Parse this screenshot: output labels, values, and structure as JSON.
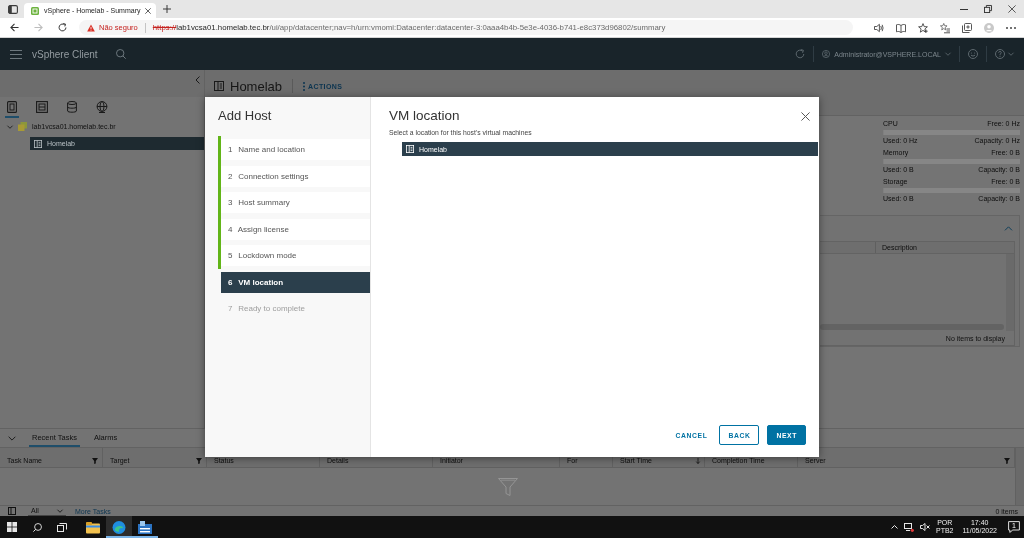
{
  "browser": {
    "tab": {
      "title": "vSphere - Homelab - Summary"
    },
    "address_bar": {
      "security_label": "Não seguro",
      "url_scheme": "https://",
      "url_host": "lab1vcsa01.homelab.tec.br",
      "url_path": "/ui/app/datacenter;nav=h/urn:vmomi:Datacenter:datacenter-3:0aaa4b4b-5e3e-4036-b741-e8c373d96802/summary"
    }
  },
  "app_header": {
    "title": "vSphere Client",
    "user": "Administrator@VSPHERE.LOCAL"
  },
  "sidebar": {
    "nav_tabs": [
      {
        "selected": true
      },
      {
        "selected": false
      },
      {
        "selected": false
      },
      {
        "selected": false
      }
    ],
    "tree": [
      {
        "label": "lab1vcsa01.homelab.tec.br",
        "expanded": true,
        "selected": false,
        "children": [
          {
            "label": "Homelab",
            "selected": true
          }
        ]
      }
    ]
  },
  "main": {
    "title": "Homelab",
    "actions": "ACTIONS",
    "resources": [
      {
        "name": "CPU",
        "free": "Free: 0 Hz",
        "used": "Used: 0 Hz",
        "capacity": "Capacity: 0 Hz",
        "level": 0
      },
      {
        "name": "Memory",
        "free": "Free: 0 B",
        "used": "Used: 0 B",
        "capacity": "Capacity: 0 B",
        "level": 0
      },
      {
        "name": "Storage",
        "free": "Free: 0 B",
        "used": "Used: 0 B",
        "capacity": "Capacity: 0 B",
        "level": 0
      }
    ],
    "panel": {
      "expanded": true,
      "columns": [
        "Description"
      ],
      "empty_text": "No items to display"
    }
  },
  "dialog": {
    "title": "Add Host",
    "steps": [
      {
        "number": "1",
        "label": "Name and location",
        "completed": true,
        "selected": false,
        "disabled": false
      },
      {
        "number": "2",
        "label": "Connection settings",
        "completed": true,
        "selected": false,
        "disabled": false
      },
      {
        "number": "3",
        "label": "Host summary",
        "completed": true,
        "selected": false,
        "disabled": false
      },
      {
        "number": "4",
        "label": "Assign license",
        "completed": true,
        "selected": false,
        "disabled": false
      },
      {
        "number": "5",
        "label": "Lockdown mode",
        "completed": true,
        "selected": false,
        "disabled": false
      },
      {
        "number": "6",
        "label": "VM location",
        "completed": false,
        "selected": true,
        "disabled": false
      },
      {
        "number": "7",
        "label": "Ready to complete",
        "completed": false,
        "selected": false,
        "disabled": true
      }
    ],
    "page_title": "VM location",
    "instruction": "Select a location for this host's virtual machines",
    "locations": [
      {
        "label": "Homelab",
        "selected": true
      }
    ],
    "buttons": [
      {
        "label": "CANCEL",
        "kind": "link"
      },
      {
        "label": "BACK",
        "kind": "secondary"
      },
      {
        "label": "NEXT",
        "kind": "primary"
      }
    ]
  },
  "recent_tasks": {
    "expanded": true,
    "tabs": [
      {
        "label": "Recent Tasks",
        "selected": true
      },
      {
        "label": "Alarms",
        "selected": false
      }
    ],
    "columns": [
      {
        "label": "Task Name",
        "filter": true,
        "sorted": false
      },
      {
        "label": "Target",
        "filter": true,
        "sorted": false
      },
      {
        "label": "Status",
        "filter": false,
        "sorted": false
      },
      {
        "label": "Details",
        "filter": false,
        "sorted": false
      },
      {
        "label": "Initiator",
        "filter": false,
        "sorted": false
      },
      {
        "label": "For",
        "filter": false,
        "sorted": false
      },
      {
        "label": "Start Time",
        "filter": false,
        "sorted": true
      },
      {
        "label": "Completion Time",
        "filter": false,
        "sorted": false
      },
      {
        "label": "Server",
        "filter": true,
        "sorted": false
      }
    ],
    "filter_value": "All",
    "more_link": "More Tasks",
    "count": "0 items"
  },
  "taskbar": {
    "apps": [
      {
        "open": false,
        "selected": false
      },
      {
        "open": true,
        "selected": true
      },
      {
        "open": true,
        "selected": false
      }
    ],
    "input_language": "POR",
    "keyboard_layout": "PTB2",
    "time": "17:40",
    "date": "11/05/2022",
    "notification_count": "1"
  }
}
